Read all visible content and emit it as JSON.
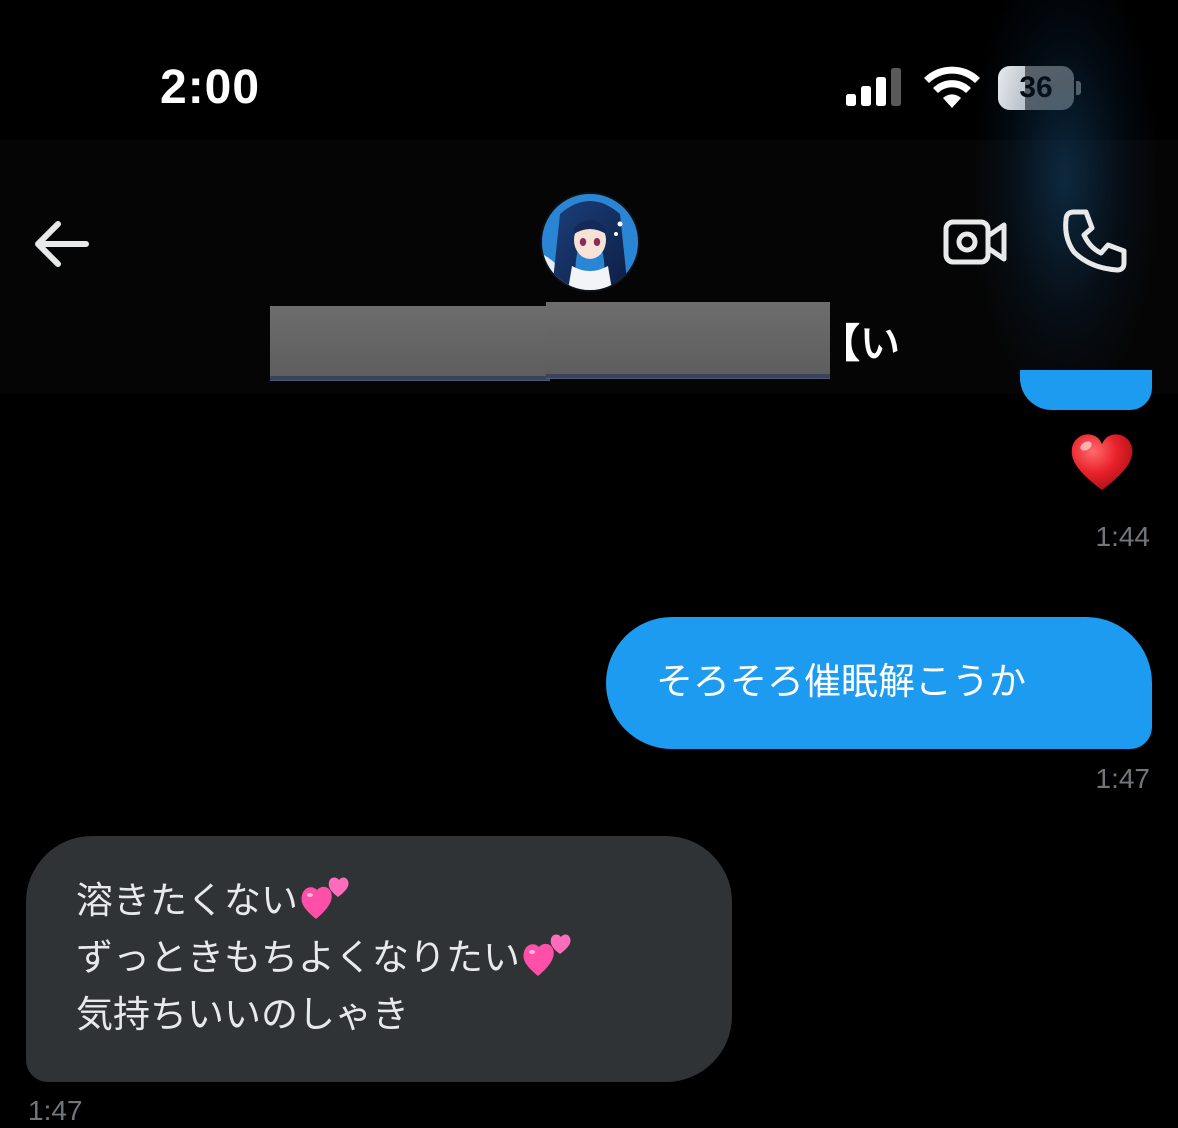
{
  "status_bar": {
    "time": "2:00",
    "battery_level": "36",
    "battery_fraction": 0.36,
    "icons": [
      "signal-icon",
      "wifi-icon",
      "battery-icon"
    ]
  },
  "header": {
    "contact_name_visible": "い】",
    "icons": [
      "back-arrow-icon",
      "avatar",
      "video-camera-icon",
      "phone-icon"
    ]
  },
  "messages": [
    {
      "direction": "sent",
      "reaction": "red-heart-emoji",
      "timestamp": "1:44"
    },
    {
      "direction": "sent",
      "text": "そろそろ催眠解こうか",
      "timestamp": "1:47"
    },
    {
      "direction": "received",
      "lines": [
        "溶きたくない",
        "ずっときもちよくなりたい",
        "気持ちいいのしゃき"
      ],
      "line_emojis": [
        "two-hearts-emoji",
        "two-hearts-emoji",
        ""
      ],
      "timestamp": "1:47"
    }
  ],
  "colors": {
    "background": "#000000",
    "sent_bubble": "#1d9bf0",
    "received_bubble": "#2f3336",
    "timestamp": "#71767b",
    "text": "#ffffff"
  }
}
